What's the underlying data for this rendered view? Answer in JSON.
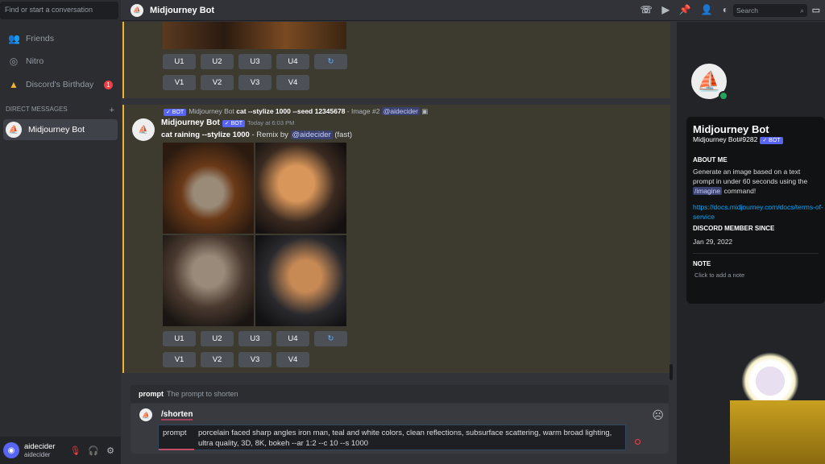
{
  "sidebar": {
    "search_placeholder": "Find or start a conversation",
    "items": [
      {
        "label": "Friends",
        "icon": "friends-icon"
      },
      {
        "label": "Nitro",
        "icon": "nitro-icon"
      },
      {
        "label": "Discord's Birthday",
        "icon": "cake-icon",
        "badge": "1"
      }
    ],
    "dm_header": "DIRECT MESSAGES",
    "dm_add": "+",
    "dms": [
      {
        "label": "Midjourney Bot"
      }
    ]
  },
  "user": {
    "name": "aidecider",
    "status": "aidecider"
  },
  "header": {
    "title": "Midjourney Bot",
    "search_placeholder": "Search"
  },
  "messages": {
    "buttons_u": [
      "U1",
      "U2",
      "U3",
      "U4"
    ],
    "buttons_v": [
      "V1",
      "V2",
      "V3",
      "V4"
    ],
    "refresh": "↻",
    "reply": {
      "author": "Midjourney Bot",
      "bot": "✓ BOT",
      "prompt": "cat --stylize 1000 --seed 12345678",
      "suffix": " - Image #2 ",
      "mention": "@aidecider"
    },
    "main": {
      "author": "Midjourney Bot",
      "bot": "✓ BOT",
      "time": "Today at 6:03 PM",
      "prompt": "cat raining --stylize 1000",
      "remix": " - Remix by ",
      "mention": "@aidecider",
      "speed": " (fast)"
    }
  },
  "profile": {
    "name": "Midjourney Bot",
    "tag": "Midjourney Bot#9282",
    "bot": "✓ BOT",
    "about_h": "ABOUT ME",
    "about_1": "Generate an image based on a text prompt in under 60 seconds using the ",
    "about_cmd": "/imagine",
    "about_2": " command!",
    "link": "https://docs.midjourney.com/docs/terms-of-service",
    "since_h": "DISCORD MEMBER SINCE",
    "since": "Jan 29, 2022",
    "note_h": "NOTE",
    "note_placeholder": "Click to add a note"
  },
  "composer": {
    "hint_name": "prompt",
    "hint_desc": "The prompt to shorten",
    "command": "/shorten",
    "option": "prompt",
    "value": "porcelain faced sharp angles iron man, teal and white colors, clean reflections, subsurface scattering, warm broad lighting, ultra quality, 3D, 8K, bokeh --ar 1:2 --c 10 --s 1000"
  }
}
